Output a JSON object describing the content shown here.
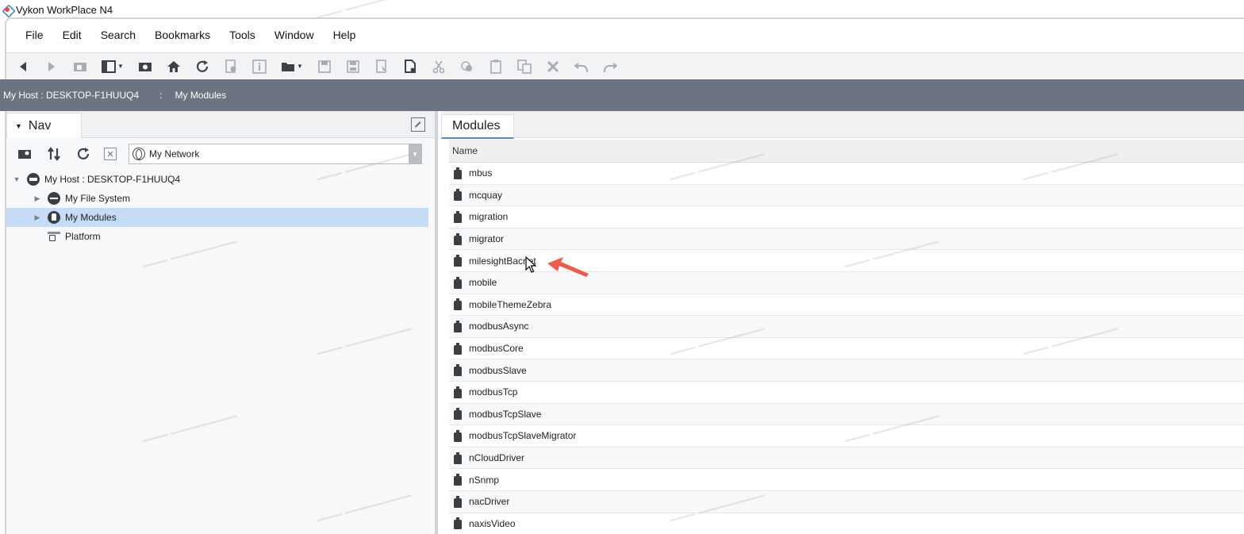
{
  "window": {
    "title": "Vykon WorkPlace N4"
  },
  "menu": [
    "File",
    "Edit",
    "Search",
    "Bookmarks",
    "Tools",
    "Window",
    "Help"
  ],
  "toolbar": {
    "buttons": [
      "back-icon",
      "forward-icon",
      "up-level-icon",
      "side-bar-icon",
      "bookmark-icon",
      "home-icon",
      "refresh-icon",
      "new-icon",
      "info-icon",
      "open-folder-icon",
      "save-icon",
      "save-all-icon",
      "export-icon",
      "spy-icon",
      "cut-icon",
      "copy-icon",
      "paste-icon",
      "duplicate-icon",
      "delete-icon",
      "undo-icon",
      "redo-icon"
    ]
  },
  "breadcrumb": {
    "host": "My Host : DESKTOP-F1HUUQ4",
    "separator": ":",
    "current": "My Modules"
  },
  "nav": {
    "tab_label": "Nav",
    "network_select": "My Network",
    "tree": [
      {
        "label": "My Host : DESKTOP-F1HUUQ4",
        "icon": "host-icon",
        "expanded": true
      },
      {
        "label": "My File System",
        "icon": "file-system-icon",
        "expanded": false
      },
      {
        "label": "My Modules",
        "icon": "modules-icon",
        "expanded": false,
        "selected": true
      },
      {
        "label": "Platform",
        "icon": "platform-icon"
      }
    ]
  },
  "modules": {
    "tab_label": "Modules",
    "column_header": "Name",
    "rows": [
      "mbus",
      "mcquay",
      "migration",
      "migrator",
      "milesightBacnet",
      "mobile",
      "mobileThemeZebra",
      "modbusAsync",
      "modbusCore",
      "modbusSlave",
      "modbusTcp",
      "modbusTcpSlave",
      "modbusTcpSlaveMigrator",
      "nCloudDriver",
      "nSnmp",
      "nacDriver",
      "naxisVideo"
    ]
  },
  "colors": {
    "address_bar": "#6b7480",
    "selection": "#c5dcf7",
    "annotation_arrow": "#f05a4a",
    "tab_accent": "#4d90d6"
  }
}
